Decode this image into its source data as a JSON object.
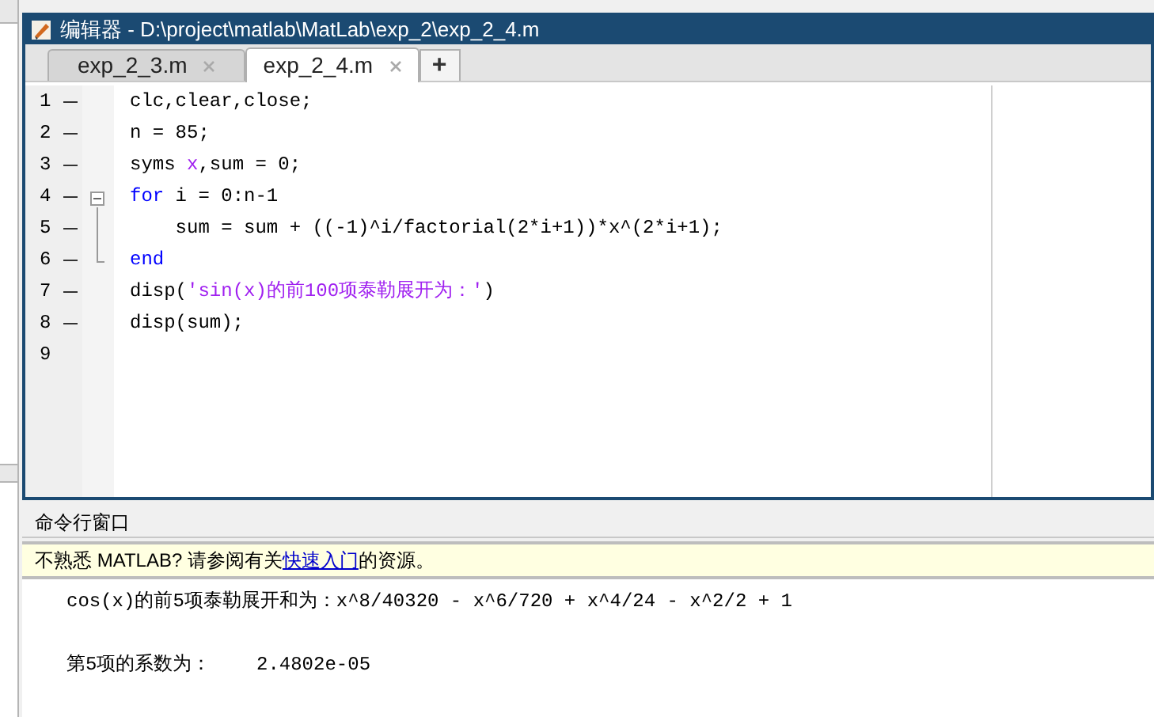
{
  "editor": {
    "title": "编辑器 - D:\\project\\matlab\\MatLab\\exp_2\\exp_2_4.m",
    "tabs": [
      {
        "label": "exp_2_3.m",
        "selected": false
      },
      {
        "label": "exp_2_4.m",
        "selected": true
      }
    ],
    "new_tab": "+",
    "lines": [
      {
        "number": "1",
        "executable": true,
        "segments": [
          {
            "kind": "plain",
            "text": "clc,clear,close;"
          }
        ]
      },
      {
        "number": "2",
        "executable": true,
        "segments": [
          {
            "kind": "plain",
            "text": "n = 85;"
          }
        ]
      },
      {
        "number": "3",
        "executable": true,
        "segments": [
          {
            "kind": "plain",
            "text": "syms "
          },
          {
            "kind": "symbol",
            "text": "x"
          },
          {
            "kind": "plain",
            "text": ",sum = 0;"
          }
        ]
      },
      {
        "number": "4",
        "executable": true,
        "fold_start": true,
        "segments": [
          {
            "kind": "keyword",
            "text": "for"
          },
          {
            "kind": "plain",
            "text": " i = 0:n-1"
          }
        ]
      },
      {
        "number": "5",
        "executable": true,
        "segments": [
          {
            "kind": "plain",
            "text": "    sum = sum + ((-1)^i/factorial(2*i+1))*x^(2*i+1);"
          }
        ]
      },
      {
        "number": "6",
        "executable": true,
        "fold_end": true,
        "segments": [
          {
            "kind": "keyword",
            "text": "end"
          }
        ]
      },
      {
        "number": "7",
        "executable": true,
        "segments": [
          {
            "kind": "plain",
            "text": "disp("
          },
          {
            "kind": "string",
            "text": "'sin(x)的前100项泰勒展开为：'"
          },
          {
            "kind": "plain",
            "text": ")"
          }
        ]
      },
      {
        "number": "8",
        "executable": true,
        "segments": [
          {
            "kind": "plain",
            "text": "disp(sum);"
          }
        ]
      },
      {
        "number": "9",
        "executable": false
      }
    ]
  },
  "command_window": {
    "title": "命令行窗口",
    "notice": {
      "before": "不熟悉 MATLAB? 请参阅有关",
      "link": "快速入门",
      "after": "的资源。"
    },
    "output": [
      "cos(x)的前5项泰勒展开和为：x^8/40320 - x^6/720 + x^4/24 - x^2/2 + 1",
      "第5项的系数为：    2.4802e-05"
    ]
  }
}
